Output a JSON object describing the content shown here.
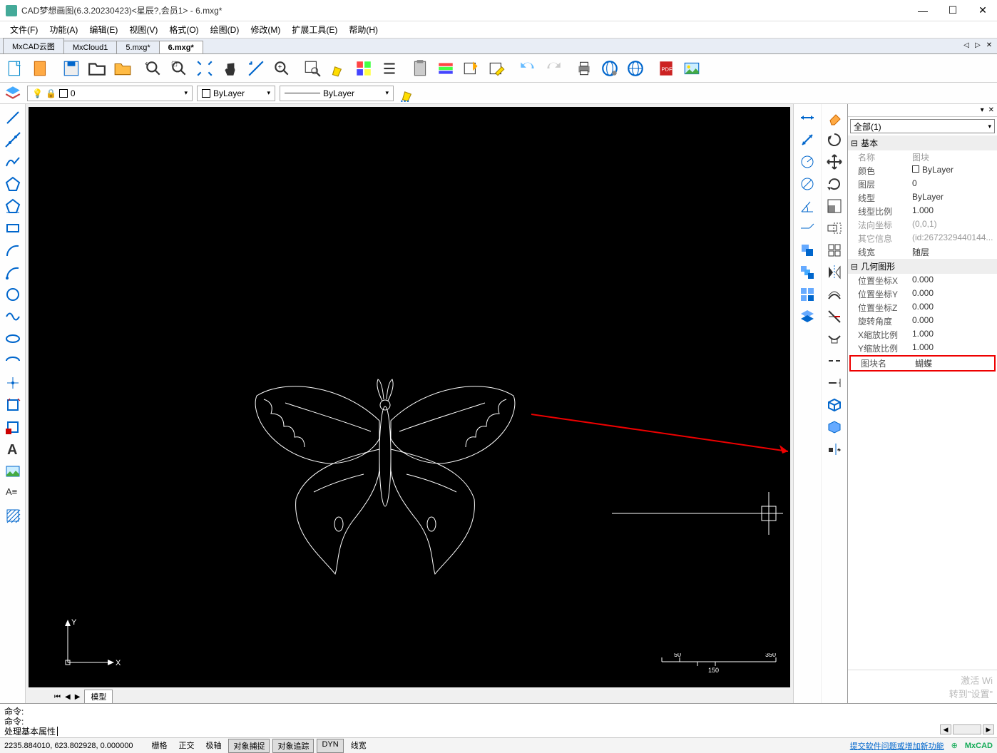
{
  "window": {
    "title": "CAD梦想画图(6.3.20230423)<星辰?,会员1> - 6.mxg*"
  },
  "menu": [
    "文件(F)",
    "功能(A)",
    "编辑(E)",
    "视图(V)",
    "格式(O)",
    "绘图(D)",
    "修改(M)",
    "扩展工具(E)",
    "帮助(H)"
  ],
  "tabs": [
    {
      "label": "MxCAD云图",
      "active": false
    },
    {
      "label": "MxCloud1",
      "active": false
    },
    {
      "label": "5.mxg*",
      "active": false
    },
    {
      "label": "6.mxg*",
      "active": true
    }
  ],
  "layer": {
    "current": "0",
    "colorLabel": "ByLayer",
    "linetype": "ByLayer"
  },
  "propSel": "全部(1)",
  "propGroups": {
    "basic": "基本",
    "geom": "几何图形"
  },
  "props": {
    "name_k": "名称",
    "name_v": "图块",
    "color_k": "颜色",
    "color_v": "ByLayer",
    "layer_k": "图层",
    "layer_v": "0",
    "ltype_k": "线型",
    "ltype_v": "ByLayer",
    "ltscale_k": "线型比例",
    "ltscale_v": "1.000",
    "normal_k": "法向坐标",
    "normal_v": "(0,0,1)",
    "other_k": "其它信息",
    "other_v": "(id:2672329440144...",
    "lw_k": "线宽",
    "lw_v": "随层",
    "posx_k": "位置坐标X",
    "posx_v": "0.000",
    "posy_k": "位置坐标Y",
    "posy_v": "0.000",
    "posz_k": "位置坐标Z",
    "posz_v": "0.000",
    "rot_k": "旋转角度",
    "rot_v": "0.000",
    "sx_k": "X缩放比例",
    "sx_v": "1.000",
    "sy_k": "Y缩放比例",
    "sy_v": "1.000",
    "bname_k": "图块名",
    "bname_v": "蝴蝶"
  },
  "footer": {
    "line1": "激活 Wi",
    "line2": "转到\"设置\""
  },
  "cmd": {
    "prompt": "命令:",
    "input": "处理基本属性 "
  },
  "status": {
    "coords": "2235.884010,  623.802928,  0.000000",
    "toggles": [
      {
        "t": "栅格",
        "on": false
      },
      {
        "t": "正交",
        "on": false
      },
      {
        "t": "极轴",
        "on": false
      },
      {
        "t": "对象捕捉",
        "on": true
      },
      {
        "t": "对象追踪",
        "on": true
      },
      {
        "t": "DYN",
        "on": true
      },
      {
        "t": "线宽",
        "on": false
      }
    ],
    "link": "提交软件问题或增加新功能",
    "brand": "MxCAD"
  },
  "modelTab": "模型",
  "scaleTicks": {
    "t50": "50",
    "t150": "150",
    "t350": "350"
  }
}
